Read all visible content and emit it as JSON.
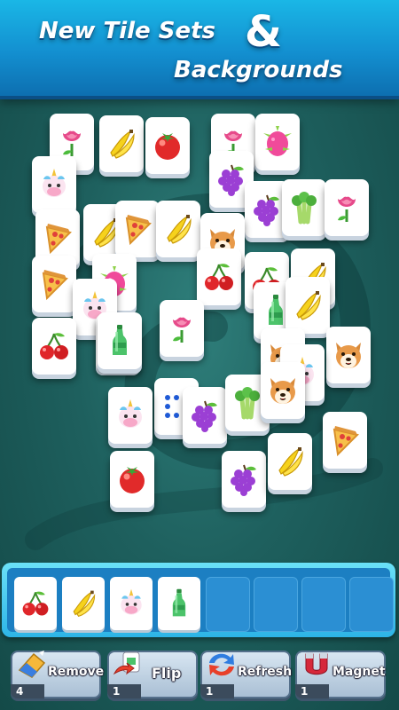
{
  "banner": {
    "line1": "New Tile Sets",
    "ampersand": "&",
    "line2": "Backgrounds"
  },
  "tiles": [
    {
      "icon": "rose-icon"
    },
    {
      "icon": "banana-icon"
    },
    {
      "icon": "tomato-icon"
    },
    {
      "icon": "rose-icon"
    },
    {
      "icon": "dragonfruit-icon"
    },
    {
      "icon": "unicorn-icon"
    },
    {
      "icon": "grapes-icon"
    },
    {
      "icon": "grapes-icon"
    },
    {
      "icon": "celery-icon"
    },
    {
      "icon": "rose-icon"
    },
    {
      "icon": "pizza-icon"
    },
    {
      "icon": "banana-icon"
    },
    {
      "icon": "pizza-icon"
    },
    {
      "icon": "banana-icon"
    },
    {
      "icon": "dog-icon"
    },
    {
      "icon": "pizza-icon"
    },
    {
      "icon": "dragonfruit-icon"
    },
    {
      "icon": "cherry-icon"
    },
    {
      "icon": "cherry-icon"
    },
    {
      "icon": "banana-icon"
    },
    {
      "icon": "unicorn-icon"
    },
    {
      "icon": "bottle-icon"
    },
    {
      "icon": "rose-icon"
    },
    {
      "icon": "bottle-icon"
    },
    {
      "icon": "banana-icon"
    },
    {
      "icon": "cherry-icon"
    },
    {
      "icon": "bottle-icon"
    },
    {
      "icon": "dog-icon"
    },
    {
      "icon": "dog-icon"
    },
    {
      "icon": "unicorn-icon"
    },
    {
      "icon": "dice-icon"
    },
    {
      "icon": "grapes-icon"
    },
    {
      "icon": "celery-icon"
    },
    {
      "icon": "dog-icon"
    },
    {
      "icon": "pizza-icon"
    },
    {
      "icon": "unicorn-icon"
    },
    {
      "icon": "tomato-icon"
    },
    {
      "icon": "grapes-icon"
    },
    {
      "icon": "banana-icon"
    }
  ],
  "tray": {
    "slots": [
      "cherry-icon",
      "banana-icon",
      "unicorn-icon",
      "bottle-icon",
      "",
      "",
      "",
      ""
    ]
  },
  "powerups": [
    {
      "label": "Remove",
      "count": "4",
      "icon": "remove-icon"
    },
    {
      "label": "Flip",
      "count": "1",
      "icon": "flip-icon"
    },
    {
      "label": "Refresh",
      "count": "1",
      "icon": "refresh-icon"
    },
    {
      "label": "Magnet",
      "count": "1",
      "icon": "magnet-icon"
    }
  ]
}
